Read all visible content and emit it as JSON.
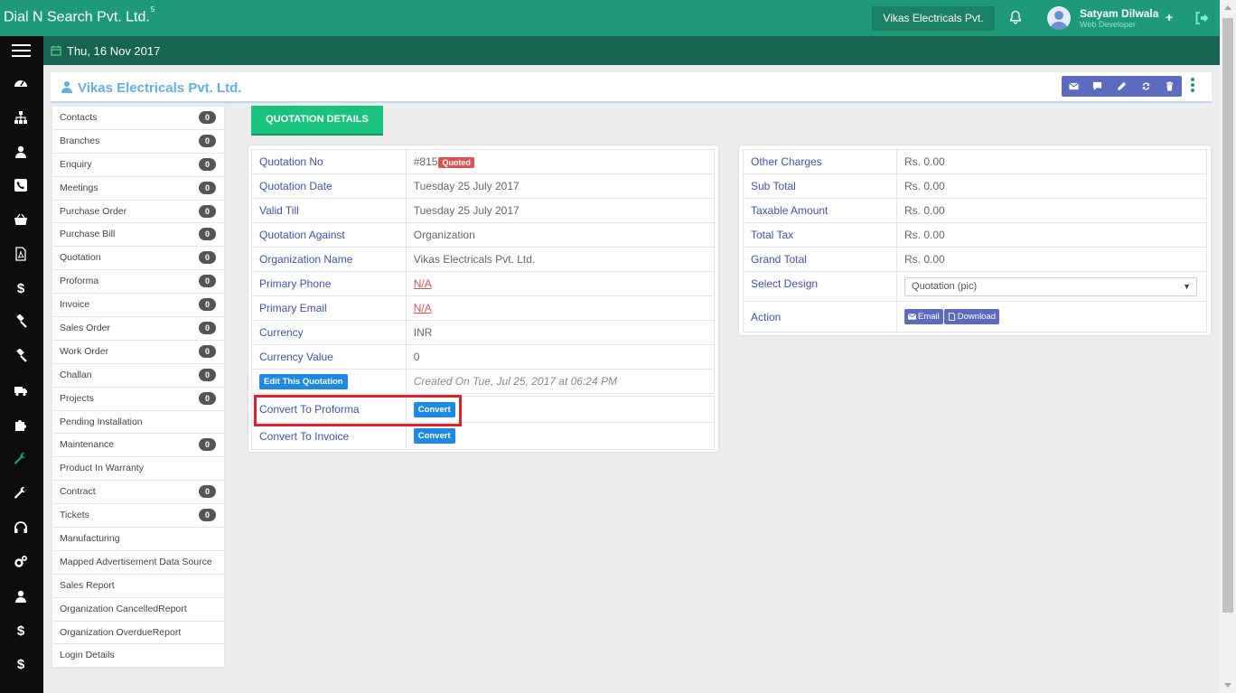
{
  "app": {
    "brand": "Dial N Search Pvt. Ltd.",
    "brand_sup": "5",
    "org_switcher": "Vikas Electricals Pvt.",
    "user": {
      "name": "Satyam Dilwala",
      "role": "Web Developer"
    },
    "date": "Thu, 16 Nov 2017"
  },
  "rail": {
    "icons": [
      "dashboard-icon",
      "sitemap-icon",
      "user-icon",
      "phone-icon",
      "basket-icon",
      "pdf-file-icon",
      "dollar-icon",
      "gavel-icon",
      "gavel-icon",
      "truck-icon",
      "puzzle-icon",
      "wrench-icon",
      "wrench-icon",
      "headphones-icon",
      "cogs-icon",
      "user-icon",
      "dollar-icon",
      "dollar-icon"
    ],
    "active_index": 11
  },
  "page": {
    "title": "Vikas Electricals Pvt. Ltd.",
    "tools": [
      "email-icon",
      "comment-icon",
      "pencil-icon",
      "refresh-icon",
      "trash-icon"
    ]
  },
  "sidemenu": [
    {
      "label": "Contacts",
      "count": "0"
    },
    {
      "label": "Branches",
      "count": "0"
    },
    {
      "label": "Enquiry",
      "count": "0"
    },
    {
      "label": "Meetings",
      "count": "0"
    },
    {
      "label": "Purchase Order",
      "count": "0"
    },
    {
      "label": "Purchase Bill",
      "count": "0"
    },
    {
      "label": "Quotation",
      "count": "0"
    },
    {
      "label": "Proforma",
      "count": "0"
    },
    {
      "label": "Invoice",
      "count": "0"
    },
    {
      "label": "Sales Order",
      "count": "0"
    },
    {
      "label": "Work Order",
      "count": "0"
    },
    {
      "label": "Challan",
      "count": "0"
    },
    {
      "label": "Projects",
      "count": "0"
    },
    {
      "label": "Pending Installation",
      "count": null
    },
    {
      "label": "Maintenance",
      "count": "0"
    },
    {
      "label": "Product In Warranty",
      "count": null
    },
    {
      "label": "Contract",
      "count": "0"
    },
    {
      "label": "Tickets",
      "count": "0"
    },
    {
      "label": "Manufacturing",
      "count": null
    },
    {
      "label": "Mapped Advertisement Data Source",
      "count": null
    },
    {
      "label": "Sales Report",
      "count": null
    },
    {
      "label": "Organization CancelledReport",
      "count": null
    },
    {
      "label": "Organization OverdueReport",
      "count": null
    },
    {
      "label": "Login Details",
      "count": null
    }
  ],
  "tab": {
    "label": "QUOTATION DETAILS"
  },
  "details": {
    "quotation_no_label": "Quotation No",
    "quotation_no": "#815",
    "status_badge": "Quoted",
    "quotation_date_label": "Quotation Date",
    "quotation_date": "Tuesday 25 July 2017",
    "valid_till_label": "Valid Till",
    "valid_till": "Tuesday 25 July 2017",
    "against_label": "Quotation Against",
    "against": "Organization",
    "org_name_label": "Organization Name",
    "org_name": "Vikas Electricals Pvt. Ltd.",
    "phone_label": "Primary Phone",
    "phone": "N/A",
    "email_label": "Primary Email",
    "email": "N/A",
    "currency_label": "Currency",
    "currency": "INR",
    "currency_value_label": "Currency Value",
    "currency_value": "0",
    "edit_button": "Edit This Quotation",
    "created_on": "Created On Tue, Jul 25, 2017 at 06:24 PM",
    "convert_proforma_label": "Convert To Proforma",
    "convert_invoice_label": "Convert To Invoice",
    "convert_button": "Convert"
  },
  "summary": {
    "other_charges_label": "Other Charges",
    "other_charges": "Rs. 0.00",
    "sub_total_label": "Sub Total",
    "sub_total": "Rs. 0.00",
    "taxable_label": "Taxable Amount",
    "taxable": "Rs. 0.00",
    "total_tax_label": "Total Tax",
    "total_tax": "Rs. 0.00",
    "grand_total_label": "Grand Total",
    "grand_total": "Rs. 0.00",
    "design_label": "Select Design",
    "design_value": "Quotation (pic)",
    "action_label": "Action",
    "email_button": "Email",
    "download_button": "Download"
  },
  "colors": {
    "topbar": "#1e9a7b",
    "subbar": "#17644f",
    "rail": "#0c0c0c",
    "label_blue": "#3f51b5",
    "badge_red": "#d9534f",
    "highlight_red": "#e0212c",
    "tab_green": "#19c27d"
  }
}
